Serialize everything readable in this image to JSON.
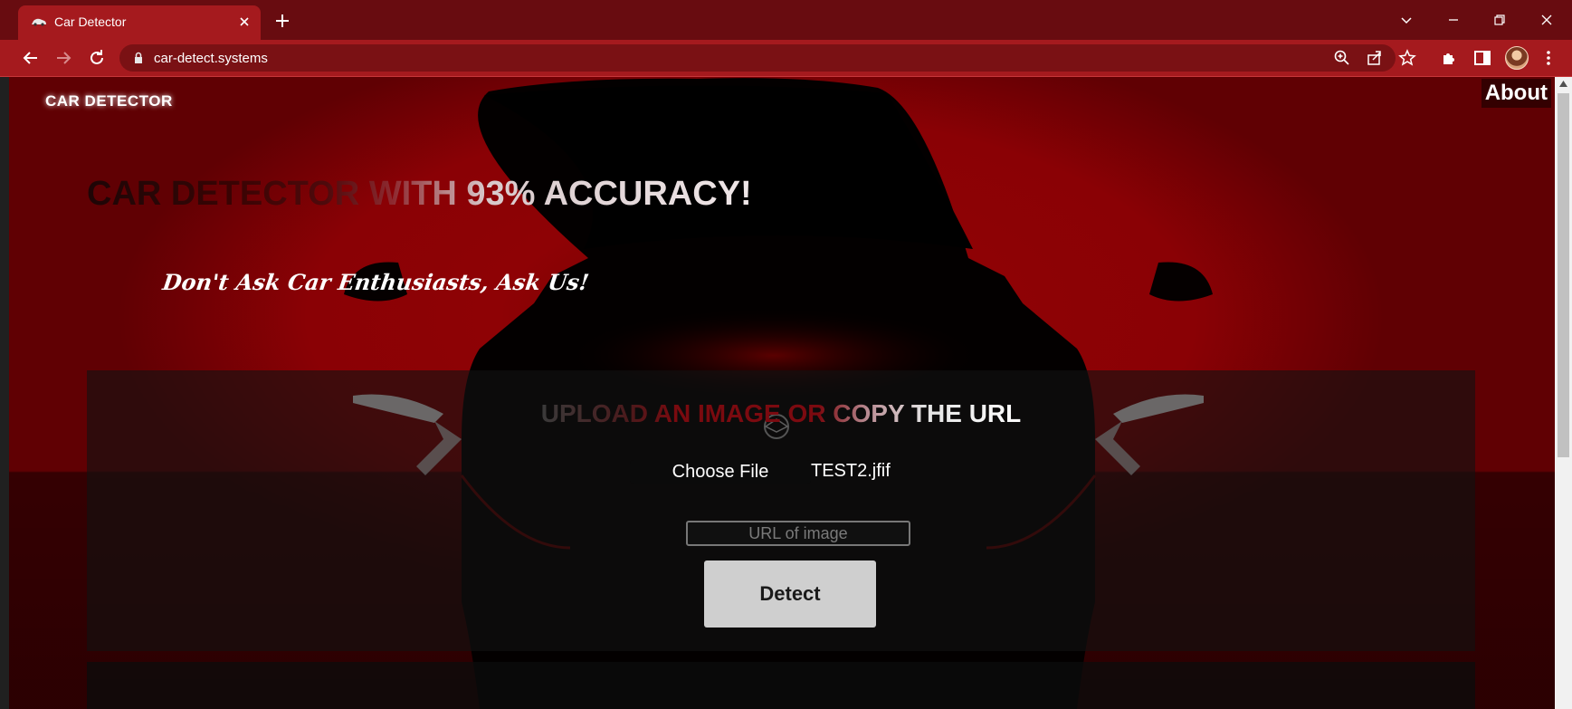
{
  "browser": {
    "tab_title": "Car Detector",
    "url": "car-detect.systems"
  },
  "site": {
    "logo_text": "CAR DETECTOR",
    "nav_about": "About",
    "headline": "CAR DETECTOR WITH 93% ACCURACY!",
    "tagline": "Don't Ask Car Enthusiasts, Ask Us!"
  },
  "upload": {
    "title": "UPLOAD AN IMAGE OR COPY THE URL",
    "choose_file_label": "Choose File",
    "file_name": "TEST2.jfif",
    "url_placeholder": "URL of image",
    "detect_label": "Detect"
  },
  "colors": {
    "chrome_tab_active": "#a51a1e",
    "chrome_bar": "#680c10",
    "page_red": "#8e0205",
    "detect_button": "#cfcfcf"
  }
}
